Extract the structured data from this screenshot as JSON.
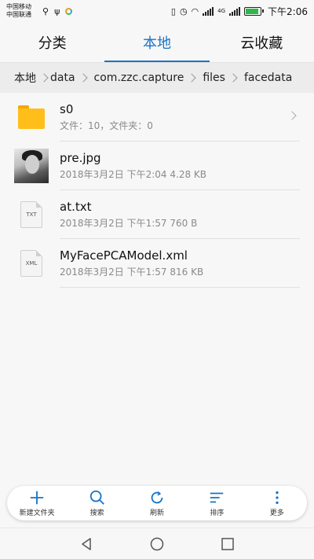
{
  "status_bar": {
    "carrier1": "中国移动",
    "carrier2": "中国联通",
    "network_label": "4G",
    "time": "下午2:06",
    "battery_level": 0.8,
    "battery_color": "#2fb84a"
  },
  "tabs": [
    {
      "label": "分类",
      "active": false
    },
    {
      "label": "本地",
      "active": true
    },
    {
      "label": "云收藏",
      "active": false
    }
  ],
  "breadcrumb": {
    "root": "本地",
    "items": [
      "data",
      "com.zzc.capture",
      "files",
      "facedata"
    ]
  },
  "files": [
    {
      "name": "s0",
      "meta": "文件：10，文件夹：0",
      "type": "folder",
      "icon": "folder-icon"
    },
    {
      "name": "pre.jpg",
      "meta": "2018年3月2日 下午2:04 4.28 KB",
      "type": "image",
      "icon": "image-thumbnail"
    },
    {
      "name": "at.txt",
      "meta": "2018年3月2日 下午1:57 760 B",
      "type": "txt",
      "icon": "txt-file-icon",
      "badge": "TXT"
    },
    {
      "name": "MyFacePCAModel.xml",
      "meta": "2018年3月2日 下午1:57 816 KB",
      "type": "xml",
      "icon": "xml-file-icon",
      "badge": "XML"
    }
  ],
  "toolbar": {
    "new_folder": "新建文件夹",
    "search": "搜索",
    "refresh": "刷新",
    "sort": "排序",
    "more": "更多"
  },
  "colors": {
    "accent": "#1a73c8",
    "folder": "#ffbe1a"
  }
}
